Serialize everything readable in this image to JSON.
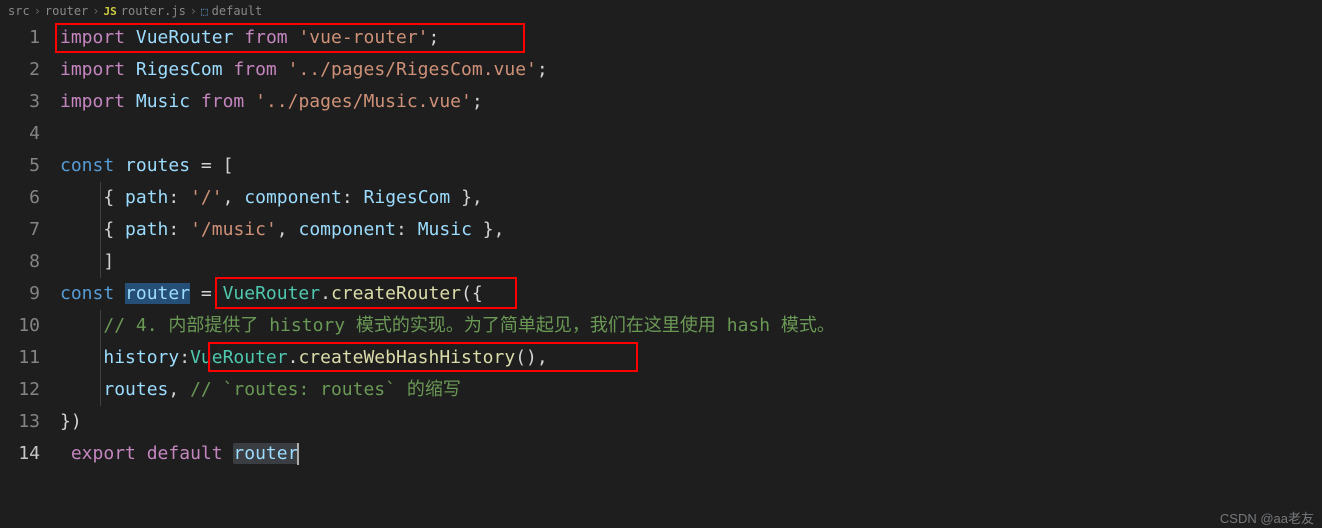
{
  "breadcrumb": {
    "part1": "src",
    "part2": "router",
    "part3": "router.js",
    "part4": "default",
    "js_badge": "JS"
  },
  "code": {
    "line1": {
      "import": "import",
      "name": "VueRouter",
      "from": "from",
      "str": "'vue-router'",
      "semi": ";"
    },
    "line2": {
      "import": "import",
      "name": "RigesCom",
      "from": "from",
      "str": "'../pages/RigesCom.vue'",
      "semi": ";"
    },
    "line3": {
      "import": "import",
      "name": "Music",
      "from": "from",
      "str": "'../pages/Music.vue'",
      "semi": ";"
    },
    "line5": {
      "const": "const",
      "name": "routes",
      "eq": " = [",
      "open": ""
    },
    "line6": {
      "open": "{ ",
      "path_key": "path",
      "colon1": ": ",
      "path_val": "'/'",
      "comma1": ", ",
      "comp_key": "component",
      "colon2": ": ",
      "comp_val": "RigesCom",
      "close": " },"
    },
    "line7": {
      "open": "{ ",
      "path_key": "path",
      "colon1": ": ",
      "path_val": "'/music'",
      "comma1": ", ",
      "comp_key": "component",
      "colon2": ": ",
      "comp_val": "Music",
      "close": " },"
    },
    "line8": {
      "close": "]"
    },
    "line9": {
      "const": "const",
      "name": "router",
      "eq": " = ",
      "class": "VueRouter",
      "dot": ".",
      "method": "createRouter",
      "paren": "({"
    },
    "line10": {
      "comment": "// 4. 内部提供了 history 模式的实现。为了简单起见，我们在这里使用 hash 模式。"
    },
    "line11": {
      "prop": "history",
      "colon": ":",
      "class": "VueRouter",
      "dot": ".",
      "method": "createWebHashHistory",
      "call": "(),"
    },
    "line12": {
      "prop": "routes",
      "comma": ", ",
      "comment": "// `routes: routes` 的缩写"
    },
    "line13": {
      "close": "})"
    },
    "line14": {
      "export": "export",
      "default": "default",
      "name": "router"
    }
  },
  "line_numbers": [
    "1",
    "2",
    "3",
    "4",
    "5",
    "6",
    "7",
    "8",
    "9",
    "10",
    "11",
    "12",
    "13",
    "14"
  ],
  "watermark": "CSDN @aa老友"
}
